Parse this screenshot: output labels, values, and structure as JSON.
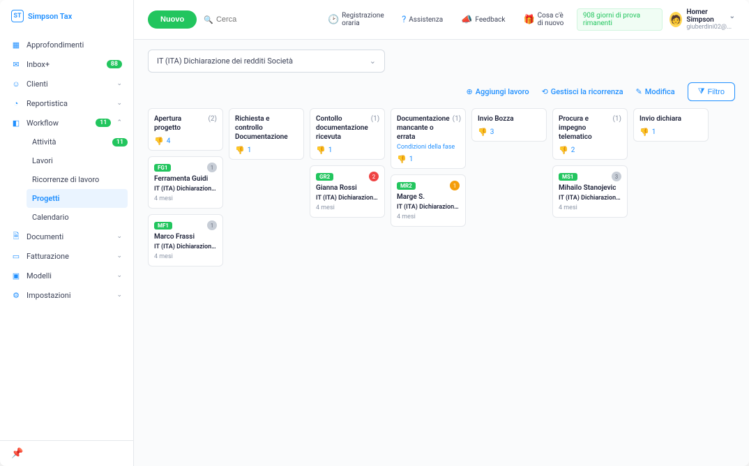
{
  "brand": {
    "initials": "ST",
    "name": "Simpson Tax"
  },
  "sidebar": {
    "items": [
      {
        "label": "Approfondimenti"
      },
      {
        "label": "Inbox+",
        "badge": "88"
      },
      {
        "label": "Clienti"
      },
      {
        "label": "Reportistica"
      },
      {
        "label": "Workflow",
        "badge": "11"
      },
      {
        "label": "Documenti"
      },
      {
        "label": "Fatturazione"
      },
      {
        "label": "Modelli"
      },
      {
        "label": "Impostazioni"
      }
    ],
    "workflow_sub": [
      {
        "label": "Attività",
        "badge": "11"
      },
      {
        "label": "Lavori"
      },
      {
        "label": "Ricorrenze di lavoro"
      },
      {
        "label": "Progetti"
      },
      {
        "label": "Calendario"
      }
    ]
  },
  "topbar": {
    "new_btn": "Nuovo",
    "search_placeholder": "Cerca",
    "links": {
      "time": "Registrazione oraria",
      "assist": "Assistenza",
      "feedback": "Feedback",
      "news": "Cosa c'è di nuovo"
    },
    "trial": "908 giorni di prova rimanenti",
    "user": {
      "name": "Homer Simpson",
      "sub": "giuberdini02@..."
    }
  },
  "select_value": "IT (ITA) Dichiarazione dei redditi Società",
  "actions": {
    "add": "Aggiungi lavoro",
    "recur": "Gestisci la ricorrenza",
    "edit": "Modifica",
    "filter": "Filtro"
  },
  "board": {
    "columns": [
      {
        "title": "Apertura progetto",
        "count": "(2)",
        "meta_count": "4",
        "cards": [
          {
            "tag": "FG1",
            "dot": "gray",
            "dot_txt": "1",
            "client": "Ferramenta Guidi",
            "desc": "IT (ITA) Dichiarazione...",
            "time": "4 mesi"
          },
          {
            "tag": "MF1",
            "dot": "gray",
            "dot_txt": "1",
            "client": "Marco Frassi",
            "desc": "IT (ITA) Dichiarazione...",
            "time": "4 mesi"
          }
        ]
      },
      {
        "title": "Richiesta e controllo Documentazione",
        "count": "",
        "meta_count": "1",
        "cards": []
      },
      {
        "title": "Contollo documentazione ricevuta",
        "count": "(1)",
        "meta_count": "1",
        "cards": [
          {
            "tag": "GR2",
            "dot": "red",
            "dot_txt": "2",
            "client": "Gianna Rossi",
            "desc": "IT (ITA) Dichiarazione...",
            "time": "4 mesi"
          }
        ]
      },
      {
        "title": "Documentazione mancante o errata",
        "count": "(1)",
        "cond": "Condizioni della fase",
        "meta_count": "1",
        "cards": [
          {
            "tag": "MR2",
            "dot": "orange",
            "dot_txt": "1",
            "client": "Marge S.",
            "desc": "IT (ITA) Dichiarazione...",
            "time": "4 mesi"
          }
        ]
      },
      {
        "title": "Invio Bozza",
        "count": "",
        "meta_count": "3",
        "cards": []
      },
      {
        "title": "Procura e impegno telematico",
        "count": "(1)",
        "meta_count": "2",
        "cards": [
          {
            "tag": "MS1",
            "dot": "gray",
            "dot_txt": "3",
            "client": "Mihailo Stanojevic",
            "desc": "IT (ITA) Dichiarazione...",
            "time": "4 mesi"
          }
        ]
      },
      {
        "title": "Invio dichiara",
        "count": "",
        "meta_count": "1",
        "cards": []
      }
    ]
  }
}
